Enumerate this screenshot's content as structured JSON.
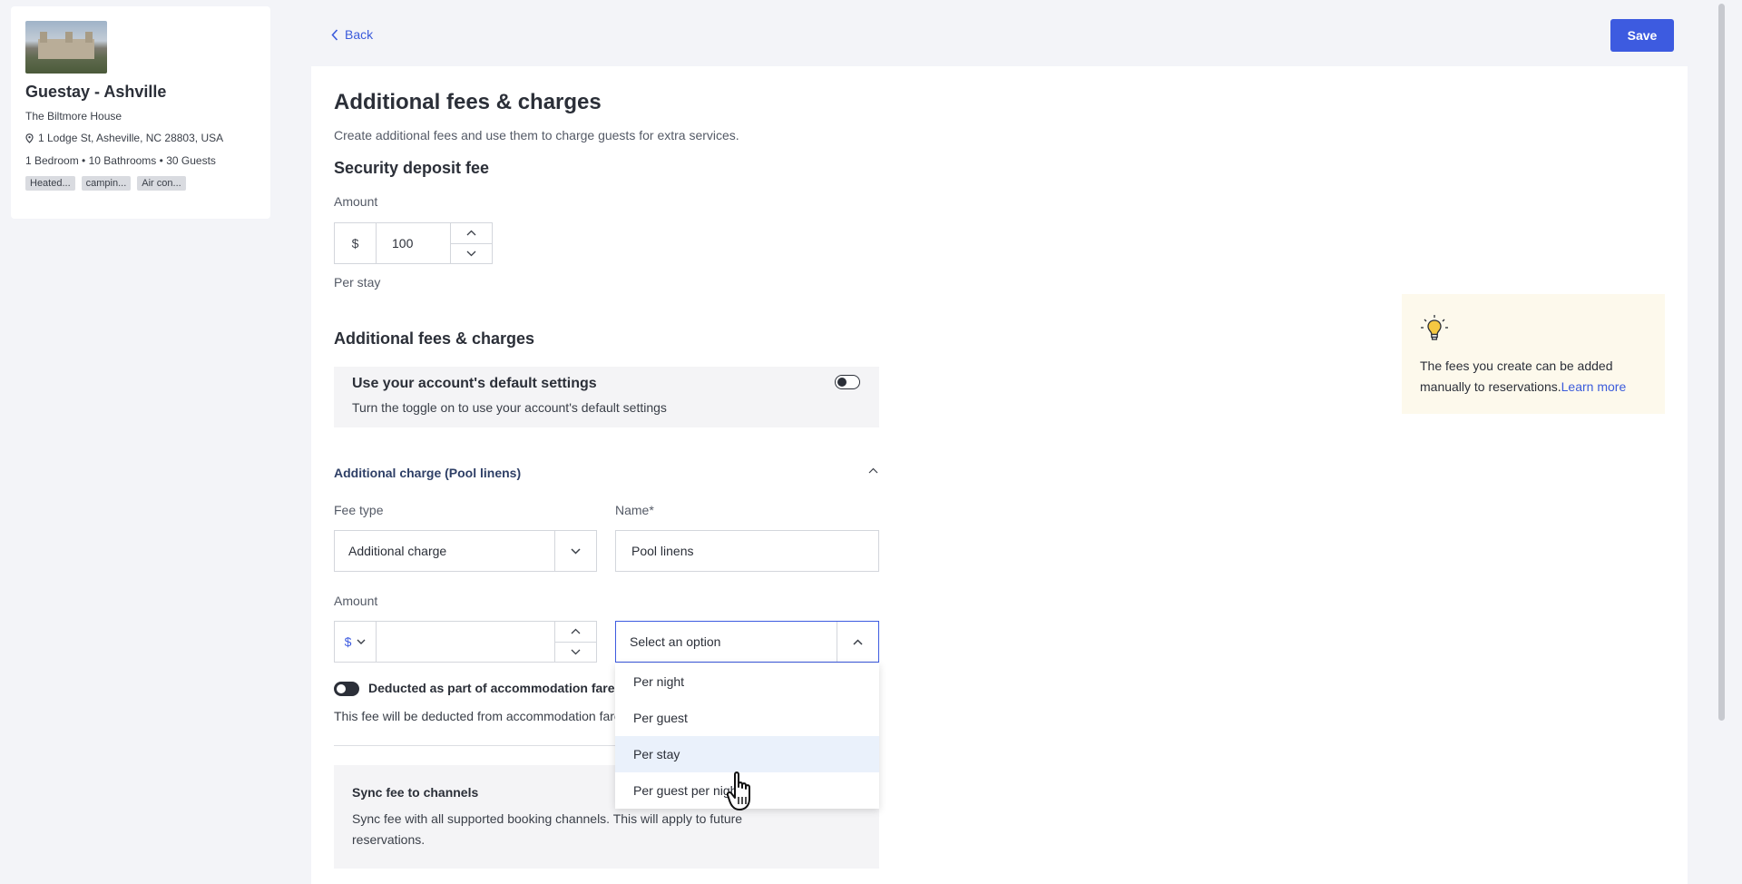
{
  "property": {
    "name": "Guestay - Ashville",
    "subtitle": "The Biltmore House",
    "address": "1 Lodge St, Asheville, NC 28803, USA",
    "bedrooms": "1 Bedroom",
    "bathrooms": "10 Bathrooms",
    "guests": "30 Guests",
    "tags": [
      "Heated...",
      "campin...",
      "Air con..."
    ]
  },
  "header": {
    "back_label": "Back",
    "save_label": "Save"
  },
  "page": {
    "title": "Additional fees & charges",
    "description": "Create additional fees and use them to charge guests for extra services."
  },
  "security_deposit": {
    "title": "Security deposit fee",
    "amount_label": "Amount",
    "currency": "$",
    "amount_value": "100",
    "frequency": "Per stay"
  },
  "additional_fees": {
    "title": "Additional fees & charges",
    "default_settings_title": "Use your account's default settings",
    "default_settings_desc": "Turn the toggle on to use your account's default settings"
  },
  "charge": {
    "section_title": "Additional charge (Pool linens)",
    "fee_type_label": "Fee type",
    "fee_type_value": "Additional charge",
    "name_label": "Name*",
    "name_value": "Pool linens",
    "amount_label": "Amount",
    "currency": "$",
    "amount_value": "",
    "frequency_placeholder": "Select an option",
    "frequency_options": [
      "Per night",
      "Per guest",
      "Per stay",
      "Per guest per night"
    ],
    "hovered_option": "Per stay",
    "deducted_label": "Deducted as part of accommodation fare",
    "deducted_desc": "This fee will be deducted from accommodation fare"
  },
  "sync": {
    "title": "Sync fee to channels",
    "desc": "Sync fee with all supported booking channels. This will apply to future reservations."
  },
  "tip": {
    "text": "The fees you create can be added manually to reservations.",
    "link": "Learn more"
  }
}
